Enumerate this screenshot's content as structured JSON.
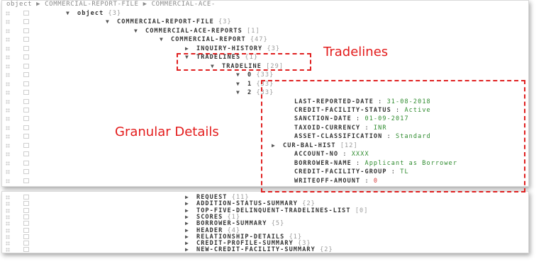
{
  "breadcrumb": "object ▶ COMMERCIAL-REPORT-FILE ▶ COMMERCIAL-ACE-",
  "top_rows": [
    {
      "arrow": "▼",
      "key": "object",
      "count": "{3}",
      "indent": 90
    },
    {
      "arrow": "▼",
      "key": "COMMERCIAL-REPORT-FILE",
      "count": "{3}",
      "indent": 146
    },
    {
      "arrow": "▼",
      "key": "COMMERCIAL-ACE-REPORTS",
      "count": "[1]",
      "indent": 186
    },
    {
      "arrow": "▼",
      "key": "COMMERCIAL-REPORT",
      "count": "{47}",
      "indent": 222
    },
    {
      "arrow": "▶",
      "key": "INQUIRY-HISTORY",
      "count": "{3}",
      "indent": 258
    },
    {
      "arrow": "▼",
      "key": "TRADELINES",
      "count": "{1}",
      "indent": 258
    },
    {
      "arrow": "▼",
      "key": "TRADELINE",
      "count": "[29]",
      "indent": 294
    },
    {
      "arrow": "▼",
      "key": "0",
      "count": "{33}",
      "indent": 330
    },
    {
      "arrow": "▼",
      "key": "1",
      "count": "{33}",
      "indent": 330
    },
    {
      "arrow": "▼",
      "key": "2",
      "count": "{33}",
      "indent": 330
    },
    {
      "arrow": "",
      "key": "LAST-REPORTED-DATE",
      "sep": " : ",
      "val": "31-08-2018",
      "val_style": "green",
      "indent": 396
    },
    {
      "arrow": "",
      "key": "CREDIT-FACILITY-STATUS",
      "sep": " : ",
      "val": "Active",
      "val_style": "green",
      "indent": 396
    },
    {
      "arrow": "",
      "key": "SANCTION-DATE",
      "sep": " : ",
      "val": "01-09-2017",
      "val_style": "green",
      "indent": 396
    },
    {
      "arrow": "",
      "key": "TAXOID-CURRENCY",
      "sep": " : ",
      "val": "INR",
      "val_style": "green",
      "indent": 396
    },
    {
      "arrow": "",
      "key": "ASSET-CLASSIFICATION",
      "sep": " : ",
      "val": "Standard",
      "val_style": "green",
      "indent": 396
    },
    {
      "arrow": "▶",
      "key": "CUR-BAL-HIST",
      "count": "[12]",
      "indent": 380
    },
    {
      "arrow": "",
      "key": "ACCOUNT-NO",
      "sep": " : ",
      "val": "XXXX",
      "val_style": "green",
      "indent": 396
    },
    {
      "arrow": "",
      "key": "BORROWER-NAME",
      "sep": " : ",
      "val": "Applicant as Borrower",
      "val_style": "green",
      "indent": 396
    },
    {
      "arrow": "",
      "key": "CREDIT-FACILITY-GROUP",
      "sep": " : ",
      "val": "TL",
      "val_style": "green",
      "indent": 396
    },
    {
      "arrow": "",
      "key": "WRITEOFF-AMOUNT",
      "sep": " : ",
      "val": "0",
      "val_style": "red",
      "indent": 396
    }
  ],
  "bottom_rows": [
    {
      "arrow": "▶",
      "key": "REQUEST",
      "count": "{11}",
      "indent": 258
    },
    {
      "arrow": "▶",
      "key": "ADDITION-STATUS-SUMMARY",
      "count": "{2}",
      "indent": 258
    },
    {
      "arrow": "▶",
      "key": "TOP-FIVE-DELINQUENT-TRADELINES-LIST",
      "count": "[0]",
      "indent": 258
    },
    {
      "arrow": "▶",
      "key": "SCORES",
      "count": "{1}",
      "indent": 258
    },
    {
      "arrow": "▶",
      "key": "BORROWER-SUMMARY",
      "count": "{5}",
      "indent": 258
    },
    {
      "arrow": "▶",
      "key": "HEADER",
      "count": "{4}",
      "indent": 258
    },
    {
      "arrow": "▶",
      "key": "RELATIONSHIP-DETAILS",
      "count": "{1}",
      "indent": 258
    },
    {
      "arrow": "▶",
      "key": "CREDIT-PROFILE-SUMMARY",
      "count": "{3}",
      "indent": 258
    },
    {
      "arrow": "▶",
      "key": "NEW-CREDIT-FACILITY-SUMMARY",
      "count": "{2}",
      "indent": 258
    }
  ],
  "annotations": {
    "tradelines_label": "Tradelines",
    "granular_label": "Granular Details"
  },
  "colors": {
    "callout": "#e02020",
    "value_green": "#2e8b2e",
    "value_red": "#d63a3a"
  }
}
